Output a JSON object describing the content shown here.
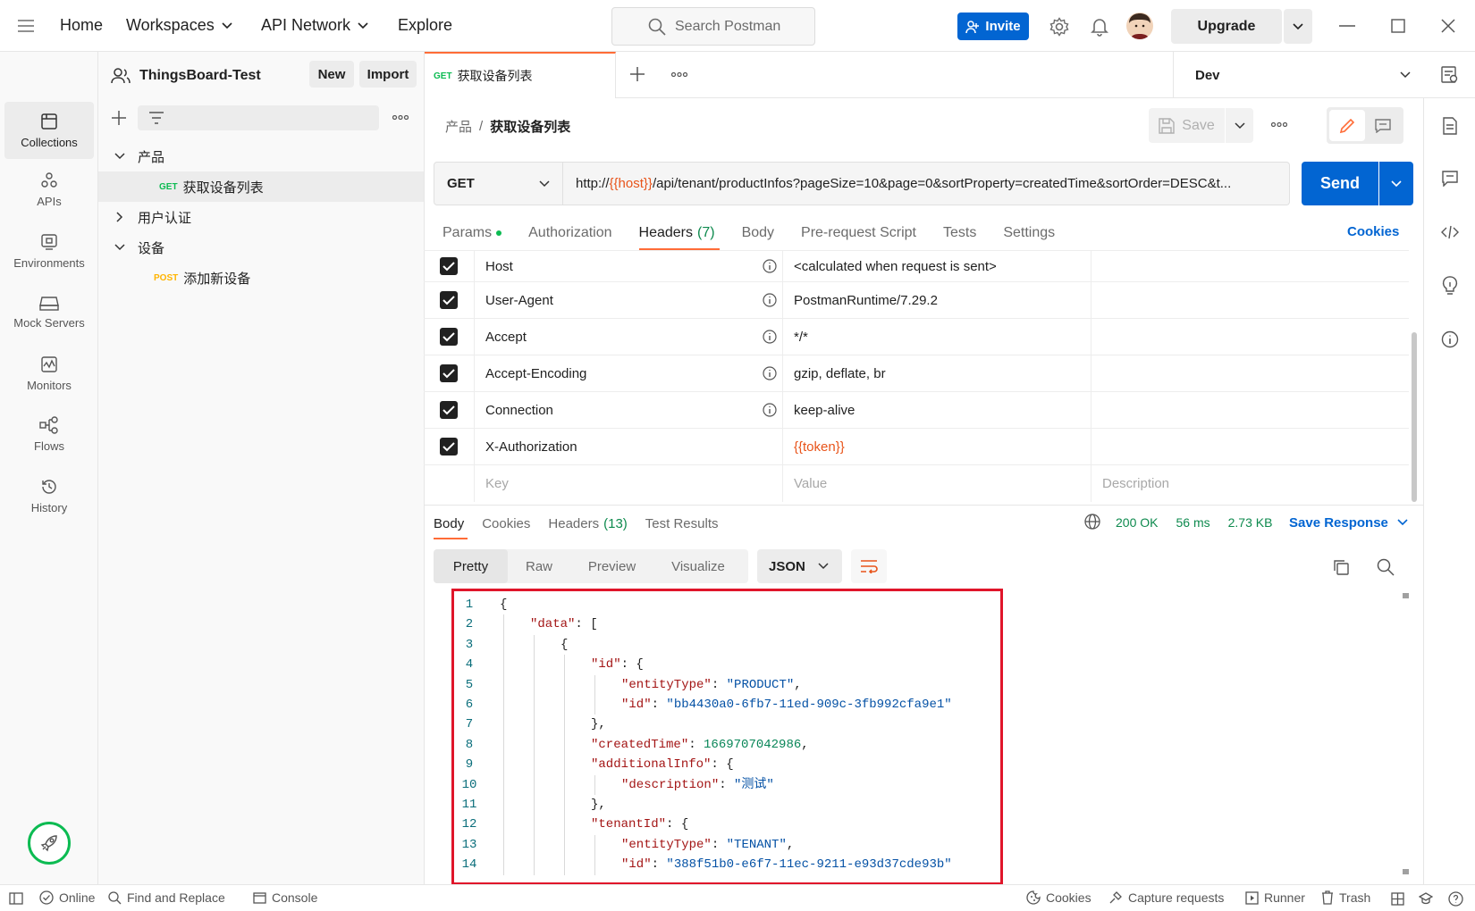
{
  "topbar": {
    "nav": [
      "Home",
      "Workspaces",
      "API Network",
      "Explore"
    ],
    "search_placeholder": "Search Postman",
    "invite_label": "Invite",
    "upgrade_label": "Upgrade"
  },
  "rail": {
    "items": [
      "Collections",
      "APIs",
      "Environments",
      "Mock Servers",
      "Monitors",
      "Flows",
      "History"
    ]
  },
  "workspace": {
    "name": "ThingsBoard-Test",
    "new_label": "New",
    "import_label": "Import"
  },
  "tree": {
    "folder1": "产品",
    "req1_method": "GET",
    "req1_name": "获取设备列表",
    "folder2": "用户认证",
    "folder3": "设备",
    "req2_method": "POST",
    "req2_name": "添加新设备"
  },
  "tab": {
    "method": "GET",
    "title": "获取设备列表"
  },
  "environment": "Dev",
  "breadcrumb": {
    "parent": "产品",
    "sep": "/",
    "current": "获取设备列表"
  },
  "save_label": "Save",
  "request": {
    "method": "GET",
    "url_prefix": "http://",
    "url_var": "{{host}}",
    "url_rest": "/api/tenant/productInfos?pageSize=10&page=0&sortProperty=createdTime&sortOrder=DESC&t...",
    "send_label": "Send"
  },
  "req_tabs": {
    "params": "Params",
    "authorization": "Authorization",
    "headers": "Headers",
    "headers_count": "(7)",
    "body": "Body",
    "prerequest": "Pre-request Script",
    "tests": "Tests",
    "settings": "Settings",
    "cookies": "Cookies"
  },
  "headers": [
    {
      "key": "Host",
      "value": "<calculated when request is sent>"
    },
    {
      "key": "User-Agent",
      "value": "PostmanRuntime/7.29.2"
    },
    {
      "key": "Accept",
      "value": "*/*"
    },
    {
      "key": "Accept-Encoding",
      "value": "gzip, deflate, br"
    },
    {
      "key": "Connection",
      "value": "keep-alive"
    },
    {
      "key": "X-Authorization",
      "value": "{{token}}"
    }
  ],
  "headers_placeholder": {
    "key": "Key",
    "value": "Value",
    "description": "Description"
  },
  "response": {
    "tabs": [
      "Body",
      "Cookies",
      "Headers",
      "Test Results"
    ],
    "headers_count": "(13)",
    "status": "200 OK",
    "time": "56 ms",
    "size": "2.73 KB",
    "save_response": "Save Response",
    "view_tabs": [
      "Pretty",
      "Raw",
      "Preview",
      "Visualize"
    ],
    "format": "JSON"
  },
  "code_lines": [
    {
      "n": "1",
      "text": "{"
    },
    {
      "n": "2",
      "text": "\"data\": ["
    },
    {
      "n": "3",
      "text": "{"
    },
    {
      "n": "4",
      "text": "\"id\": {"
    },
    {
      "n": "5",
      "text": "\"entityType\": \"PRODUCT\","
    },
    {
      "n": "6",
      "text": "\"id\": \"bb4430a0-6fb7-11ed-909c-3fb992cfa9e1\""
    },
    {
      "n": "7",
      "text": "},"
    },
    {
      "n": "8",
      "text": "\"createdTime\": 1669707042986,"
    },
    {
      "n": "9",
      "text": "\"additionalInfo\": {"
    },
    {
      "n": "10",
      "text": "\"description\": \"测试\""
    },
    {
      "n": "11",
      "text": "},"
    },
    {
      "n": "12",
      "text": "\"tenantId\": {"
    },
    {
      "n": "13",
      "text": "\"entityType\": \"TENANT\","
    },
    {
      "n": "14",
      "text": "\"id\": \"388f51b0-e6f7-11ec-9211-e93d37cde93b\""
    }
  ],
  "statusbar": {
    "online": "Online",
    "find_replace": "Find and Replace",
    "console": "Console",
    "cookies": "Cookies",
    "capture": "Capture requests",
    "runner": "Runner",
    "trash": "Trash"
  },
  "colors": {
    "accent": "#ff6c37",
    "brand_blue": "#0265d2",
    "get_green": "#0cbb52",
    "post_yellow": "#ffb400",
    "variable_orange": "#e8541a",
    "highlight_red": "#e0152a",
    "ok_green": "#0e8a4e"
  }
}
